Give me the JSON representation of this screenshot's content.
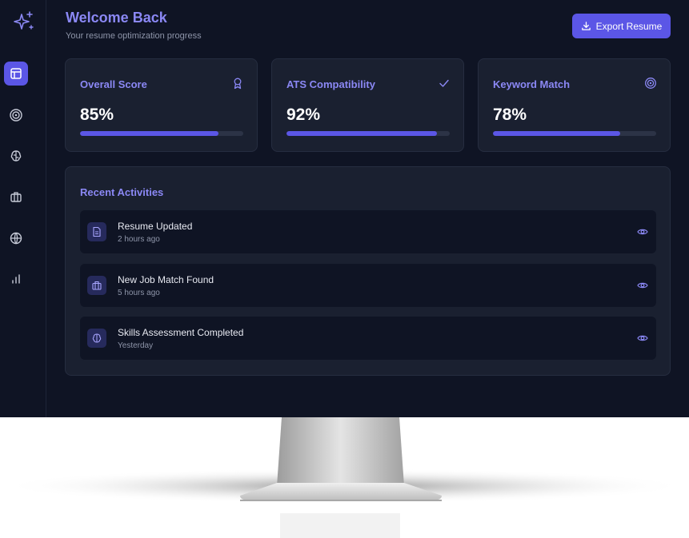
{
  "header": {
    "title": "Welcome Back",
    "subtitle": "Your resume optimization progress",
    "export_label": "Export Resume"
  },
  "sidebar": {
    "items": [
      {
        "icon": "layout-icon",
        "active": true
      },
      {
        "icon": "target-icon",
        "active": false
      },
      {
        "icon": "brain-icon",
        "active": false
      },
      {
        "icon": "briefcase-icon",
        "active": false
      },
      {
        "icon": "globe-icon",
        "active": false
      },
      {
        "icon": "bar-chart-icon",
        "active": false
      }
    ]
  },
  "metrics": [
    {
      "label": "Overall Score",
      "value": "85%",
      "progress": 0.85,
      "icon": "award-icon"
    },
    {
      "label": "ATS Compatibility",
      "value": "92%",
      "progress": 0.92,
      "icon": "check-icon"
    },
    {
      "label": "Keyword Match",
      "value": "78%",
      "progress": 0.78,
      "icon": "target-icon"
    }
  ],
  "activities": {
    "title": "Recent Activities",
    "items": [
      {
        "title": "Resume Updated",
        "time": "2 hours ago",
        "icon": "document-icon"
      },
      {
        "title": "New Job Match Found",
        "time": "5 hours ago",
        "icon": "briefcase-icon"
      },
      {
        "title": "Skills Assessment Completed",
        "time": "Yesterday",
        "icon": "brain-icon"
      }
    ]
  },
  "colors": {
    "accent": "#5b56e6",
    "accent_text": "#8b88f5",
    "background": "#0f1424",
    "card": "#1a2030"
  }
}
